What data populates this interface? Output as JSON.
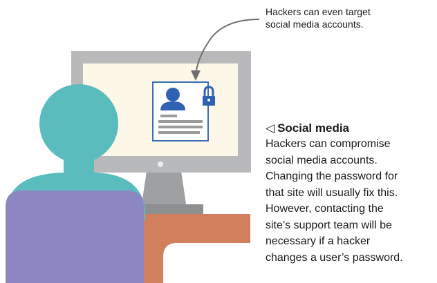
{
  "callout": {
    "lines": [
      "Hackers can even target",
      "social media accounts."
    ]
  },
  "caption": {
    "marker": "◁",
    "title": "Social media",
    "body_lines": [
      "Hackers can compromise",
      "social media accounts.",
      "Changing the password for",
      "that site will usually fix this.",
      "However, contacting the",
      "site’s support team will be",
      "necessary if a hacker",
      "changes a user’s password."
    ]
  },
  "colors": {
    "monitor_frame": "#b8b9bb",
    "screen": "#fcf7e6",
    "profile_border": "#3a6ab8",
    "profile_icon": "#2f62b3",
    "person_skin": "#5bbcbd",
    "shirt": "#8c87c3",
    "desk": "#d27f5d"
  },
  "icons": [
    "user-avatar-icon",
    "padlock-icon"
  ]
}
